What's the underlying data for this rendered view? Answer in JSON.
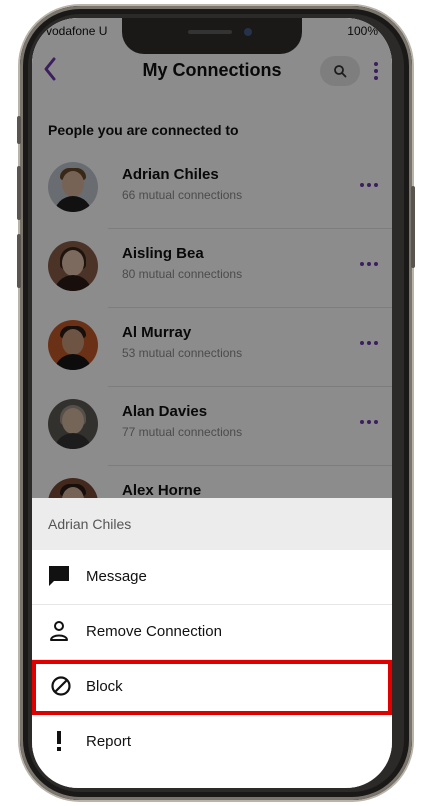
{
  "status_bar": {
    "carrier": "vodafone U",
    "battery": "100%"
  },
  "header": {
    "title": "My Connections",
    "back_icon": "back-chevron-icon",
    "search_icon": "search-icon",
    "more_icon": "more-vertical-icon"
  },
  "section_title": "People you are connected to",
  "connections": [
    {
      "name": "Adrian Chiles",
      "mutual": "66 mutual connections"
    },
    {
      "name": "Aisling Bea",
      "mutual": "80 mutual connections"
    },
    {
      "name": "Al Murray",
      "mutual": "53 mutual connections"
    },
    {
      "name": "Alan Davies",
      "mutual": "77 mutual connections"
    },
    {
      "name": "Alex Horne",
      "mutual": ""
    }
  ],
  "action_sheet": {
    "title": "Adrian Chiles",
    "options": [
      {
        "label": "Message",
        "icon": "message-icon"
      },
      {
        "label": "Remove Connection",
        "icon": "person-icon"
      },
      {
        "label": "Block",
        "icon": "block-icon",
        "highlighted": true
      },
      {
        "label": "Report",
        "icon": "exclamation-icon"
      }
    ]
  },
  "colors": {
    "accent": "#6a3aa8",
    "highlight": "#e00000"
  }
}
